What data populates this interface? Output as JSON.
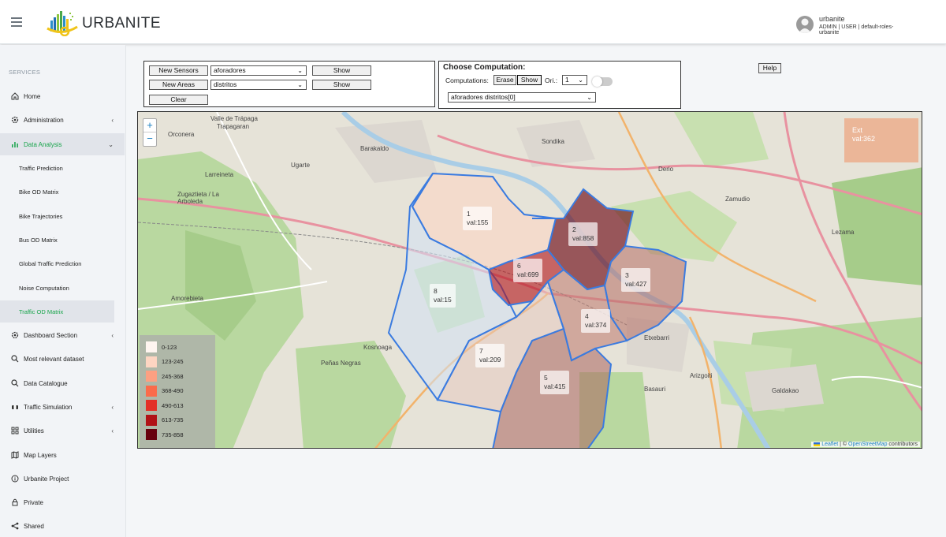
{
  "app": {
    "brand": "URBANITE",
    "user_name": "urbanite",
    "user_roles": "ADMIN | USER | default-roles-urbanite"
  },
  "sidebar": {
    "heading": "SERVICES",
    "items": [
      {
        "label": "Home",
        "icon": "home-icon"
      },
      {
        "label": "Administration",
        "icon": "gear-icon"
      },
      {
        "label": "Data Analysis",
        "icon": "bar-chart-icon"
      },
      {
        "label": "Dashboard Section",
        "icon": "gear-icon"
      },
      {
        "label": "Most relevant dataset",
        "icon": "search-icon"
      },
      {
        "label": "Data Catalogue",
        "icon": "search-icon"
      },
      {
        "label": "Traffic Simulation",
        "icon": "car-icon"
      },
      {
        "label": "Utilities",
        "icon": "grid-icon"
      },
      {
        "label": "Map Layers",
        "icon": "map-icon"
      },
      {
        "label": "Urbanite Project",
        "icon": "info-icon"
      },
      {
        "label": "Private",
        "icon": "lock-icon"
      },
      {
        "label": "Shared",
        "icon": "share-icon"
      }
    ],
    "sub_items": [
      "Traffic Prediction",
      "Bike OD Matrix",
      "Bike Trajectories",
      "Bus OD Matrix",
      "Global Traffic Prediction",
      "Noise Computation",
      "Traffic OD Matrix"
    ]
  },
  "controls": {
    "new_sensors_label": "New Sensors",
    "sensors_select_value": "aforadores",
    "show_label": "Show",
    "new_areas_label": "New Areas",
    "areas_select_value": "distritos",
    "clear_label": "Clear",
    "computation_title": "Choose Computation:",
    "computations_label": "Computations:",
    "erase_label": "Erase",
    "ori_label": "Ori.:",
    "ori_value": "1",
    "computation_select_value": "aforadores distritos[0]",
    "help_label": "Help"
  },
  "map": {
    "zoom_in": "+",
    "zoom_out": "−",
    "ext_title": "Ext",
    "ext_value": "val:362",
    "areas": [
      {
        "id": "1",
        "value": "val:155"
      },
      {
        "id": "2",
        "value": "val:858"
      },
      {
        "id": "3",
        "value": "val:427"
      },
      {
        "id": "4",
        "value": "val:374"
      },
      {
        "id": "5",
        "value": "val:415"
      },
      {
        "id": "6",
        "value": "val:699"
      },
      {
        "id": "7",
        "value": "val:209"
      },
      {
        "id": "8",
        "value": "val:15"
      }
    ],
    "places": [
      "Valle de Trápaga",
      "Trapagaran",
      "Barakaldo",
      "Orconera",
      "Larreineta",
      "Ugarte",
      "Zugaztieta / La Arboleda",
      "Etxebarri",
      "Basauri",
      "Galdakao",
      "Arizgoiti",
      "Lezama",
      "Zamudio",
      "Derio",
      "Sondika",
      "Amorebieta",
      "Peñas Negras",
      "Kosnoaga"
    ],
    "legend": [
      {
        "label": "0-123",
        "color": "#fff5f0"
      },
      {
        "label": "123-245",
        "color": "#fdd5c2"
      },
      {
        "label": "245-368",
        "color": "#fca082"
      },
      {
        "label": "368-490",
        "color": "#fb6b4b"
      },
      {
        "label": "490-613",
        "color": "#e32f27"
      },
      {
        "label": "613-735",
        "color": "#b11117"
      },
      {
        "label": "735-858",
        "color": "#67000d"
      }
    ],
    "attribution_leaflet": "Leaflet",
    "attribution_sep": "| ©",
    "attribution_osm": "OpenStreetMap",
    "attribution_tail": "contributors"
  }
}
